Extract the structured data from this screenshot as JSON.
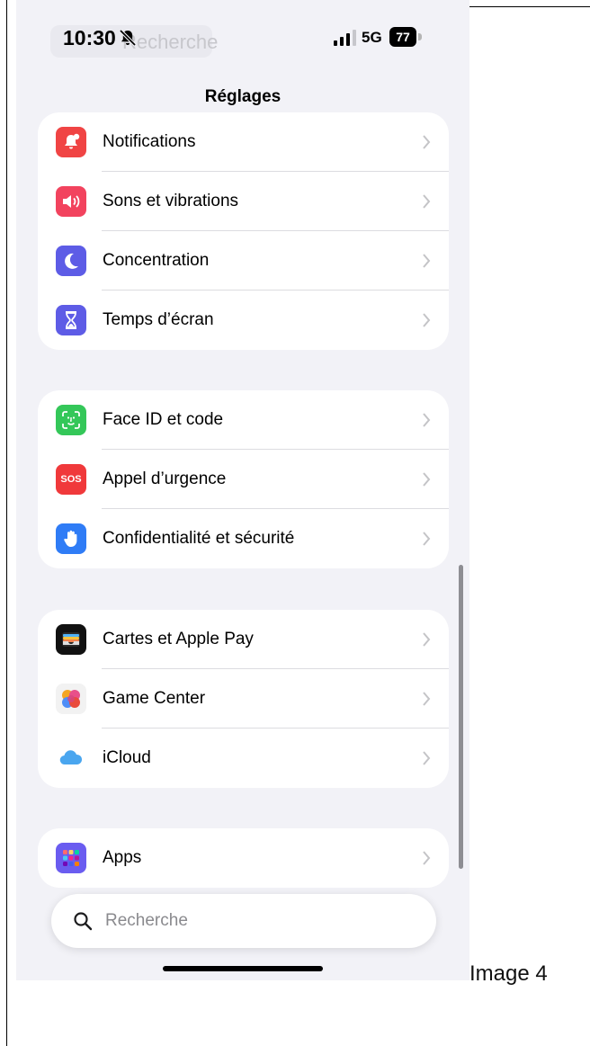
{
  "status": {
    "time": "10:30",
    "network": "5G",
    "battery": "77",
    "ghost_search": "Recherche"
  },
  "title": "Réglages",
  "groups": [
    {
      "rows": [
        {
          "label": "Notifications",
          "icon": "bell-badge-icon",
          "color": "#f04444"
        },
        {
          "label": "Sons et vibrations",
          "icon": "speaker-icon",
          "color": "#f2435e"
        },
        {
          "label": "Concentration",
          "icon": "moon-icon",
          "color": "#5d5ce6"
        },
        {
          "label": "Temps d’écran",
          "icon": "hourglass-icon",
          "color": "#5e5ce6"
        }
      ]
    },
    {
      "rows": [
        {
          "label": "Face ID et code",
          "icon": "face-id-icon",
          "color": "#34c759"
        },
        {
          "label": "Appel d’urgence",
          "icon": "sos-icon",
          "color": "#f0393b",
          "badge": "SOS"
        },
        {
          "label": "Confidentialité et sécurité",
          "icon": "hand-icon",
          "color": "#2f7cf6"
        }
      ]
    },
    {
      "rows": [
        {
          "label": "Cartes et Apple Pay",
          "icon": "wallet-icon",
          "color": "#111111"
        },
        {
          "label": "Game Center",
          "icon": "game-center-icon",
          "color": "#f2f2f2"
        },
        {
          "label": "iCloud",
          "icon": "cloud-icon",
          "color": "#ffffff"
        }
      ]
    },
    {
      "rows": [
        {
          "label": "Apps",
          "icon": "apps-grid-icon",
          "color": "#6a5cf0"
        }
      ]
    }
  ],
  "search": {
    "placeholder": "Recherche"
  },
  "caption": "Image 4"
}
